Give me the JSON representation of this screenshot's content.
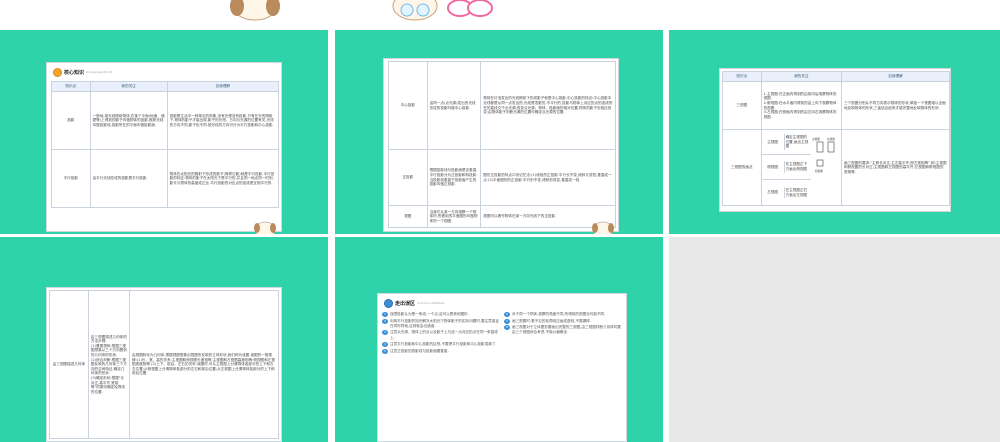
{
  "slide1": {
    "banner_label": "核心知识",
    "banner_sub": "Knowledge Points",
    "headers": [
      "知识点",
      "我的关注",
      "自我理解"
    ],
    "rows": [
      {
        "k": "投影",
        "a": "一般地,用光线照射物体,在某个平面(地面、墙壁等)上得到的影子叫做物体的投影,照射光线叫做投影线,投影所在的平面叫做投影面.",
        "b": "投影是生活中一种常见的现象,没有光便没有投影.只有在光的照射下,物体的影子才能出现,影子的长短、方向与光源的位置有关,光线的方向不同,影子也不同.按光线的方向可分为平行投影和中心投影."
      },
      {
        "k": "平行投影",
        "a": "由平行光线形成的投影是平行投影.",
        "b": "物体在太阳光的照射下形成的影子(简称日影)就是平行投影.平行投影的特征:物体的影子在太阳光下是平行的,并且同一地点同一时刻,影长与物体的高度成正比.平行投影的对应点的连线是互相平行的."
      }
    ]
  },
  "slide2": {
    "rows": [
      {
        "k": "中心投影",
        "a": "由同一点(点光源)发出的光线形成的投影叫做中心投影.",
        "b": "物体在灯泡发出的光线照射下形成影子就是中心投影.中心投影的特征:中心投影中光线都是从同一点发出的,光线是发散的,不平行的,投影与物体上对应的点的连线所在的直线交于点光源;改变点光源、物体、投影面的相对位置,物体的影子也相应改变;由物体影子判断光源的位置可确定点光源的位置."
      },
      {
        "k": "正投影",
        "a": "根据投影线与投影面是否垂直,平行投影分为正投影和斜投影.当投影线垂直于投影面产生的投影叫做正投影.",
        "b": "图形正投影的特点口诀记忆法:(1)线段的正投影:平行长不变,倾斜长变短,垂直成一点.(2)平面图形的正投影:平行形不变,倾斜形改变,垂直成一线."
      },
      {
        "k": "视图",
        "a": "当我们从某一方向观察一个物体时,所看到的平面图形叫做物体的一个视图.",
        "b": "视图可以看作物体在某一方向光线下的正投影."
      }
    ]
  },
  "slide3": {
    "headers": [
      "知识点",
      "我的关注",
      "自我理解"
    ],
    "row1": {
      "k": "三视图",
      "a": "1.主视图:在正面内得到的由前向后观察物体的视图.\n2.俯视图:在水平面内得到的由上向下观察物体的视图.\n3.左视图:在侧面内得到的由左向右观察物体的视图.",
      "b": "三个视图分别从不同方向表示物体的形状,单独一个视图难以全面地反映物体的形状,三者结合起来才能完整地反映物体的形状."
    },
    "row2": {
      "k": "三视图的画法",
      "items": [
        {
          "name": "主视图",
          "desc": "确定主视图的位置,画出主视图"
        },
        {
          "name": "俯视图",
          "desc": "在主视图正下方画出俯视图"
        },
        {
          "name": "左视图",
          "desc": "在主视图正右方画出左视图"
        }
      ],
      "view_labels": [
        "主视图",
        "左视图",
        "俯视图"
      ],
      "b": "画三视图的要求:\"主俯长对正,主左高平齐,俯左宽相等\",即:主视图和俯视图的长对正;主视图和左视图的高平齐;左视图和俯视图的宽相等."
    }
  },
  "slide4": {
    "k": "由三视图描述几何体",
    "a": "由三视图描述几何体的方法步骤:\n(1)看图想体:根据三视图想象从三个方向看到的几何体的形状.\n(2)综合判断:根据三视图反映的几何体三个方向的空间特征,确定几何体的形状.\n(3)确定形状:根据\"长对正,高平齐,宽相等\"的原则确定轮廓线的位置.",
    "b": "由视图转化为几何体,根据视图想象出视图所反映的立体形状,我们称为读图.读图的一般规律:(1)长、宽、高的关系:主视图和俯视图长度相等;主视图和左视图高度相等;俯视图和左视图宽度相等.(2)上下、前后、左右的关系:读图时,可从主视图上分清物体各部分的上下和左右位置;从俯视图上分清物体各部分的左右和前后位置;从左视图上分清物体各部分的上下和前后位置."
  },
  "slide5": {
    "banner_label": "走出误区",
    "banner_sub": "Common Mistakes",
    "left": [
      "误把投影认为是一条线,一个点,这可以是其他图形.",
      "利用平行投影的知识解决太阳光下物体影子的实际问题时,要注意保证在同时同地,否则就会出错误.",
      "注意点光源、物体上的点以及影子上与这一点对应的点在同一条直线上.",
      "注意平行投影和中心投影的区别,不要把平行投影和中心投影混淆了.",
      "注意正投影的投影线与投影面要垂直."
    ],
    "right": [
      "对于同一个物体,观察的角度不同,所得到的视图也可能不同.",
      "画三视图时,看不见的轮廓线应画成虚线,不要漏掉.",
      "画三视图对于立体图形要画出完整的三视图,由三视图判断几何体时要由三个视图综合考虑,不能以偏概全."
    ]
  }
}
